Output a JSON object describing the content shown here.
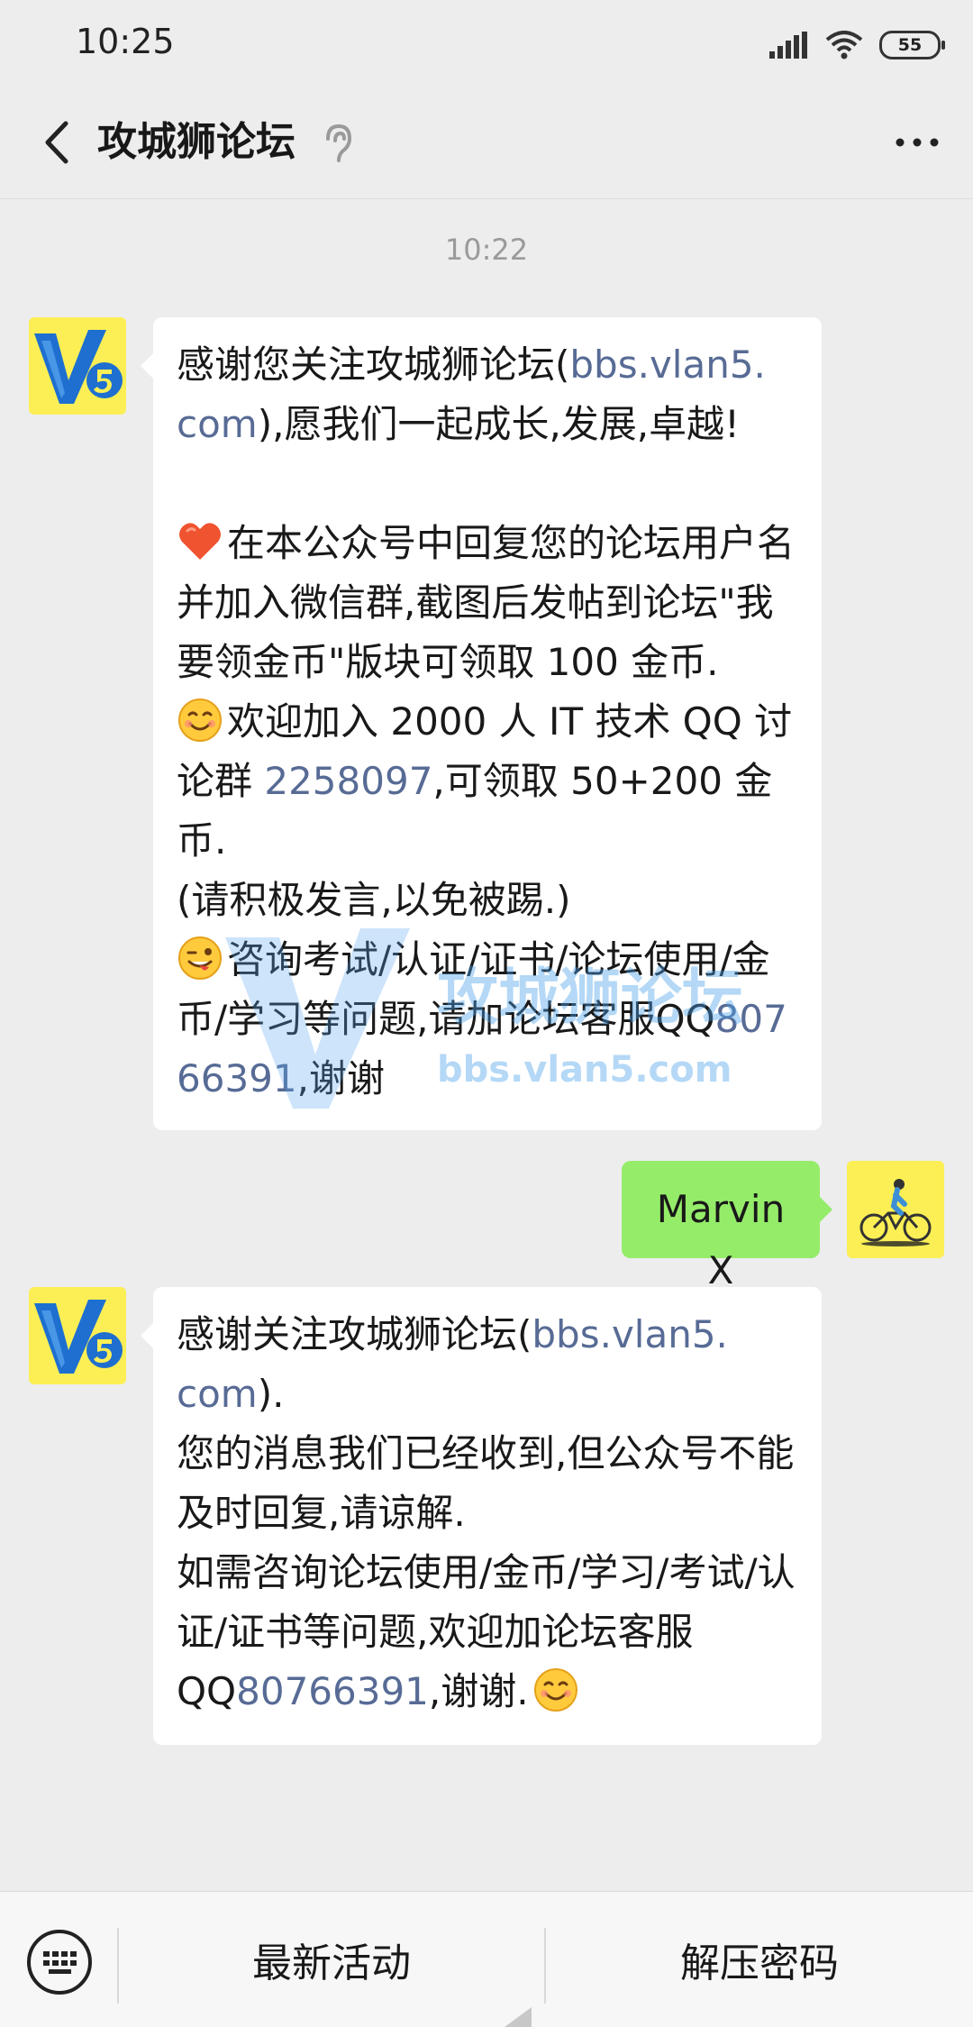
{
  "status": {
    "time": "10:25",
    "battery": "55"
  },
  "header": {
    "title": "攻城狮论坛"
  },
  "chat": {
    "timestamp": "10:22",
    "msg1": {
      "l1a": "感谢您关注攻城狮论坛(",
      "l1link": "bbs.vlan5.",
      "l2link": "com",
      "l2b": "),愿我们一起成长,发展,卓越!",
      "p2": "在本公众号中回复您的论坛用户名并加入微信群,截图后发帖到论坛\"我要领金币\"版块可领取 100 金币.",
      "p3a": "欢迎加入 2000 人 IT 技术 QQ 讨论群 ",
      "p3link": "2258097",
      "p3b": ",可领取 50+200 金币.",
      "p4": "(请积极发言,以免被踢.)",
      "p5a": "咨询考试/认证/证书/论坛使用/金币/学习等问题,请加论坛客服QQ",
      "p5link": "80766391",
      "p5b": ",谢谢"
    },
    "msg2": {
      "text": "MarvinX"
    },
    "msg3": {
      "l1a": "感谢关注攻城狮论坛(",
      "l1link": "bbs.vlan5.",
      "l2link": "com",
      "l2b": ").",
      "p2": "您的消息我们已经收到,但公众号不能及时回复,请谅解.",
      "p3": "如需咨询论坛使用/金币/学习/考试/认证/证书等问题,欢迎加论坛客服",
      "p4a": "QQ",
      "p4link": "80766391",
      "p4b": ",谢谢."
    },
    "watermark": {
      "title": "攻城狮论坛",
      "url": "bbs.vlan5.com"
    }
  },
  "bottom": {
    "menu1": "最新活动",
    "menu2": "解压密码"
  },
  "icons": [
    "signal-icon",
    "wifi-icon",
    "battery-icon",
    "back-icon",
    "ear-icon",
    "more-icon",
    "keyboard-icon",
    "heart-emoji",
    "smile-emoji",
    "wink-emoji"
  ]
}
